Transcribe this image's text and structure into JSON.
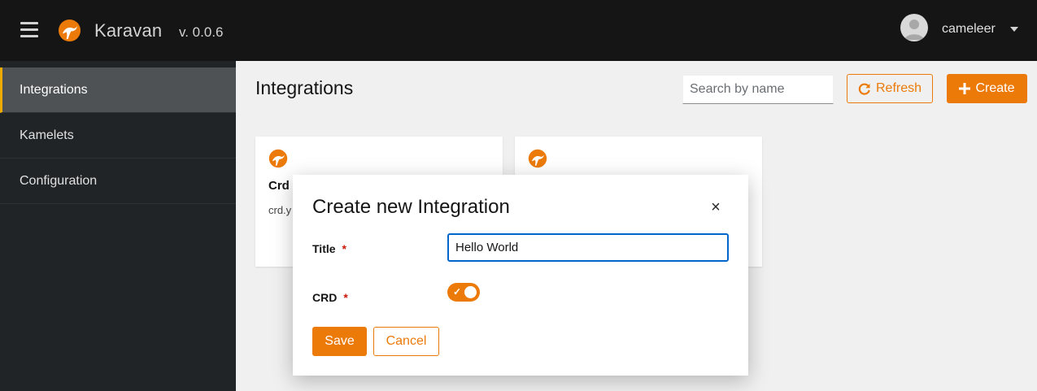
{
  "header": {
    "app_name": "Karavan",
    "version": "v. 0.0.6",
    "user_name": "cameleer",
    "icons": {
      "menu": "hamburger-icon",
      "logo": "camel-logo-icon",
      "avatar": "user-avatar-icon",
      "caret": "caret-down-icon"
    }
  },
  "sidebar": {
    "items": [
      {
        "label": "Integrations",
        "active": true
      },
      {
        "label": "Kamelets",
        "active": false
      },
      {
        "label": "Configuration",
        "active": false
      }
    ]
  },
  "main": {
    "title": "Integrations",
    "search_placeholder": "Search by name",
    "refresh_label": "Refresh",
    "create_label": "Create",
    "cards": [
      {
        "title": "Crd",
        "file": "crd.y"
      },
      {
        "title": "",
        "file": ""
      }
    ]
  },
  "modal": {
    "title": "Create new Integration",
    "close_label": "×",
    "fields": {
      "title_label": "Title",
      "title_value": "Hello World",
      "crd_label": "CRD",
      "crd_enabled": true,
      "required_mark": "*"
    },
    "save_label": "Save",
    "cancel_label": "Cancel"
  },
  "colors": {
    "accent": "#ec7a08",
    "header_bg": "#151515",
    "sidebar_bg": "#212427",
    "focus": "#0066cc"
  }
}
